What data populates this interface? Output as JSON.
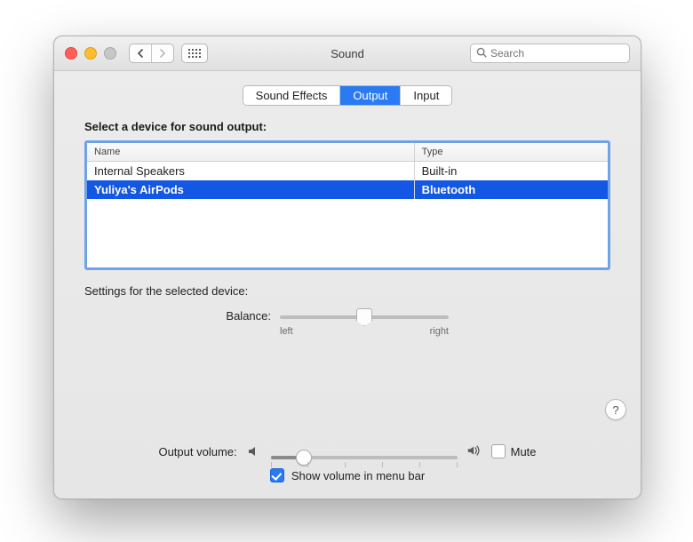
{
  "window": {
    "title": "Sound"
  },
  "search": {
    "placeholder": "Search"
  },
  "tabs": [
    {
      "label": "Sound Effects",
      "active": false
    },
    {
      "label": "Output",
      "active": true
    },
    {
      "label": "Input",
      "active": false
    }
  ],
  "section": {
    "select_title": "Select a device for sound output:",
    "columns": {
      "name": "Name",
      "type": "Type"
    },
    "devices": [
      {
        "name": "Internal Speakers",
        "type": "Built-in",
        "selected": false
      },
      {
        "name": "Yuliya's AirPods",
        "type": "Bluetooth",
        "selected": true
      }
    ],
    "settings_label": "Settings for the selected device:",
    "balance": {
      "label": "Balance:",
      "left": "left",
      "right": "right",
      "value_pct": 50
    }
  },
  "footer": {
    "output_volume_label": "Output volume:",
    "volume_pct": 18,
    "mute_label": "Mute",
    "mute_checked": false,
    "show_in_menu_label": "Show volume in menu bar",
    "show_in_menu_checked": true
  },
  "help_glyph": "?"
}
